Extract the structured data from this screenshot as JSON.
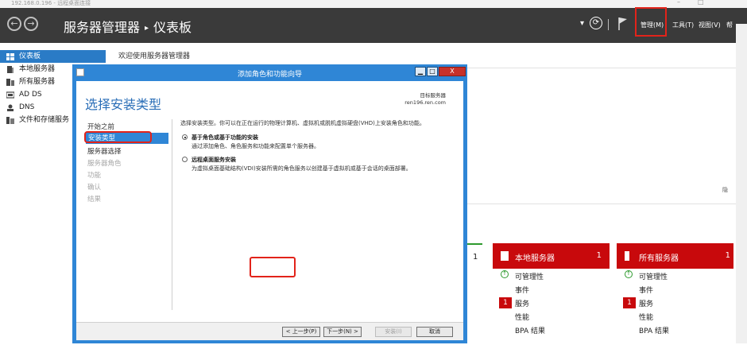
{
  "rdp": {
    "title": "192.168.0.196 - 远程桌面连接",
    "min": "–",
    "max": "□"
  },
  "header": {
    "crumb_root": "服务器管理器",
    "crumb_sep": "▸",
    "crumb_current": "仪表板",
    "back_glyph": "←",
    "fwd_glyph": "→",
    "dropdown_glyph": "▾",
    "refresh_glyph": "⟳",
    "menus": {
      "manage": "管理(M)",
      "tools": "工具(T)",
      "view": "视图(V)"
    },
    "help": "帮"
  },
  "sidebar": {
    "items": [
      {
        "label": "仪表板",
        "icon": "dashboard-icon"
      },
      {
        "label": "本地服务器",
        "icon": "server-icon"
      },
      {
        "label": "所有服务器",
        "icon": "servers-icon"
      },
      {
        "label": "AD DS",
        "icon": "ad-icon"
      },
      {
        "label": "DNS",
        "icon": "dns-icon"
      },
      {
        "label": "文件和存储服务",
        "icon": "storage-icon"
      }
    ]
  },
  "main": {
    "welcome": "欢迎使用服务器管理器",
    "hide_label": "隐"
  },
  "tiles": {
    "partial_count": "1",
    "local": {
      "title": "本地服务器",
      "count": "1",
      "rows": [
        {
          "label": "可管理性",
          "badge": "ok"
        },
        {
          "label": "事件",
          "badge": ""
        },
        {
          "label": "服务",
          "badge": "1"
        },
        {
          "label": "性能",
          "badge": ""
        },
        {
          "label": "BPA 结果",
          "badge": ""
        }
      ]
    },
    "all": {
      "title": "所有服务器",
      "count": "1",
      "rows": [
        {
          "label": "可管理性",
          "badge": "ok"
        },
        {
          "label": "事件",
          "badge": ""
        },
        {
          "label": "服务",
          "badge": "1"
        },
        {
          "label": "性能",
          "badge": ""
        },
        {
          "label": "BPA 结果",
          "badge": ""
        }
      ]
    }
  },
  "dialog": {
    "title": "添加角色和功能向导",
    "win_min": "▁",
    "win_max": "□",
    "win_close": "X",
    "heading": "选择安装类型",
    "dest_label": "目标服务器",
    "dest_server": "ren196.ren.com",
    "steps": [
      {
        "label": "开始之前",
        "state": "normal"
      },
      {
        "label": "安装类型",
        "state": "current"
      },
      {
        "label": "服务器选择",
        "state": "normal"
      },
      {
        "label": "服务器角色",
        "state": "disabled"
      },
      {
        "label": "功能",
        "state": "disabled"
      },
      {
        "label": "确认",
        "state": "disabled"
      },
      {
        "label": "结果",
        "state": "disabled"
      }
    ],
    "intro": "选择安装类型。你可以在正在运行的物理计算机、虚拟机或脱机虚拟硬盘(VHD)上安装角色和功能。",
    "options": [
      {
        "title": "基于角色或基于功能的安装",
        "desc": "通过添加角色、角色服务和功能来配置单个服务器。",
        "selected": true
      },
      {
        "title": "远程桌面服务安装",
        "desc": "为虚拟桌面基础结构(VDI)安装所需的角色服务以创建基于虚拟机或基于会话的桌面部署。",
        "selected": false
      }
    ],
    "buttons": {
      "prev": "< 上一步(P)",
      "next": "下一步(N) >",
      "install": "安装(I)",
      "cancel": "取消"
    }
  }
}
